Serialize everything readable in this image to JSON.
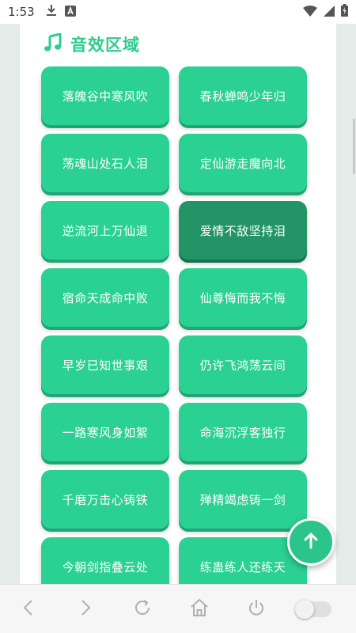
{
  "status_bar": {
    "time": "1:53",
    "icons": [
      "download-icon",
      "app-a-icon",
      "wifi-icon",
      "signal-icon",
      "battery-charging-icon"
    ]
  },
  "section": {
    "title": "音效区域",
    "icon": "music-note-icon",
    "accent_color": "#2ecc8e"
  },
  "effects": [
    {
      "label": "落魄谷中寒风吹"
    },
    {
      "label": "春秋蝉鸣少年归"
    },
    {
      "label": "荡魂山处石人泪"
    },
    {
      "label": "定仙游走魔向北"
    },
    {
      "label": "逆流河上万仙退"
    },
    {
      "label": "爱情不敌坚持泪",
      "active": true
    },
    {
      "label": "宿命天成命中败"
    },
    {
      "label": "仙尊悔而我不悔"
    },
    {
      "label": "早岁已知世事艰"
    },
    {
      "label": "仍许飞鸿荡云间"
    },
    {
      "label": "一路寒风身如絮"
    },
    {
      "label": "命海沉浮客独行"
    },
    {
      "label": "千磨万击心铸铁"
    },
    {
      "label": "殚精竭虑铸一剑"
    },
    {
      "label": "今朝剑指叠云处"
    },
    {
      "label": "练蛊练人还练天"
    }
  ],
  "colors": {
    "button": "#2bd093",
    "button_active": "#239466",
    "page_bg": "#e4ebe8"
  },
  "scroll_top": {
    "icon": "arrow-up-icon"
  },
  "bottom_nav": {
    "items": [
      "back-icon",
      "forward-icon",
      "refresh-icon",
      "home-icon",
      "power-icon"
    ],
    "toggle": "off"
  }
}
